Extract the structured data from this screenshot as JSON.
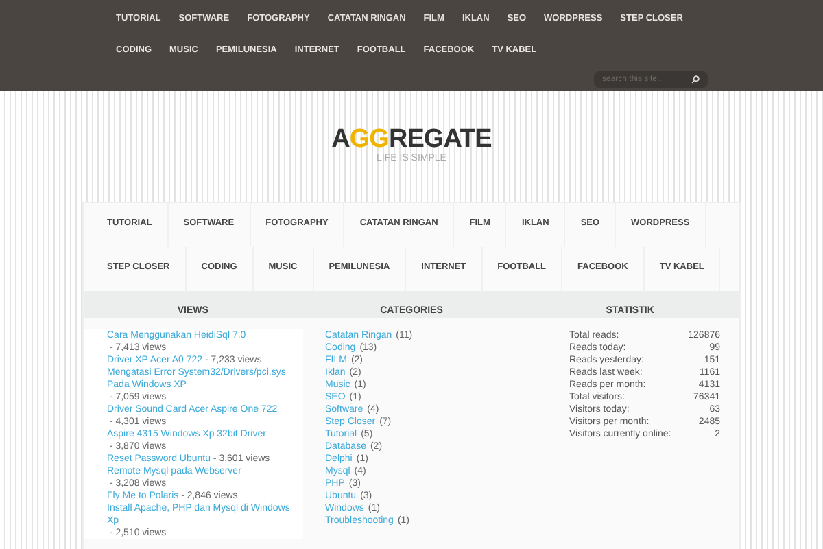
{
  "top_nav": [
    "TUTORIAL",
    "SOFTWARE",
    "FOTOGRAPHY",
    "CATATAN RINGAN",
    "FILM",
    "IKLAN",
    "SEO",
    "WORDPRESS",
    "STEP CLOSER",
    "CODING",
    "MUSIC",
    "PEMILUNESIA",
    "INTERNET",
    "FOOTBALL",
    "FACEBOOK",
    "TV KABEL"
  ],
  "search": {
    "placeholder": "search this site..."
  },
  "logo": {
    "start": "A",
    "accent": "GG",
    "end": "REGATE",
    "tagline": "LIFE IS SIMPLE"
  },
  "main_nav": [
    "TUTORIAL",
    "SOFTWARE",
    "FOTOGRAPHY",
    "CATATAN RINGAN",
    "FILM",
    "IKLAN",
    "SEO",
    "WORDPRESS",
    "STEP CLOSER",
    "CODING",
    "MUSIC",
    "PEMILUNESIA",
    "INTERNET",
    "FOOTBALL",
    "FACEBOOK",
    "TV KABEL"
  ],
  "columns": [
    "VIEWS",
    "CATEGORIES",
    "STATISTIK"
  ],
  "views": [
    {
      "title": "Cara Menggunakan HeidiSql 7.0",
      "count": " - 7,413 views"
    },
    {
      "title": "Driver XP Acer A0 722",
      "count": " - 7,233 views"
    },
    {
      "title": "Mengatasi Error System32/Drivers/pci.sys Pada Windows XP",
      "count": " - 7,059 views"
    },
    {
      "title": "Driver Sound Card Acer Aspire One 722",
      "count": " - 4,301 views"
    },
    {
      "title": "Aspire 4315 Windows Xp 32bit Driver",
      "count": " - 3,870 views"
    },
    {
      "title": "Reset Password Ubuntu",
      "count": " - 3,601 views"
    },
    {
      "title": "Remote Mysql pada Webserver",
      "count": " - 3,208 views"
    },
    {
      "title": "Fly Me to Polaris",
      "count": " - 2,846 views"
    },
    {
      "title": "Install Apache, PHP dan Mysql di Windows Xp",
      "count": " - 2,510 views"
    }
  ],
  "categories": [
    {
      "name": "Catatan Ringan",
      "count": "(11)"
    },
    {
      "name": "Coding",
      "count": "(13)"
    },
    {
      "name": "FILM",
      "count": "(2)"
    },
    {
      "name": "Iklan",
      "count": "(2)"
    },
    {
      "name": "Music",
      "count": "(1)"
    },
    {
      "name": "SEO",
      "count": "(1)"
    },
    {
      "name": "Software",
      "count": "(4)"
    },
    {
      "name": "Step Closer",
      "count": "(7)"
    },
    {
      "name": "Tutorial",
      "count": "(5)"
    },
    {
      "name": "Database",
      "count": "(2)"
    },
    {
      "name": "Delphi",
      "count": "(1)"
    },
    {
      "name": "Mysql",
      "count": "(4)"
    },
    {
      "name": "PHP",
      "count": "(3)"
    },
    {
      "name": "Ubuntu",
      "count": "(3)"
    },
    {
      "name": "Windows",
      "count": "(1)"
    },
    {
      "name": "Troubleshooting",
      "count": "(1)"
    }
  ],
  "stats": [
    {
      "label": "Total reads:",
      "value": "126876"
    },
    {
      "label": "Reads today:",
      "value": "99"
    },
    {
      "label": "Reads yesterday:",
      "value": "151"
    },
    {
      "label": "Reads last week:",
      "value": "1161"
    },
    {
      "label": "Reads per month:",
      "value": "4131"
    },
    {
      "label": "Total visitors:",
      "value": "76341"
    },
    {
      "label": "Visitors today:",
      "value": "63"
    },
    {
      "label": "Visitors per month:",
      "value": "2485"
    },
    {
      "label": "Visitors currently online:",
      "value": "2"
    }
  ]
}
